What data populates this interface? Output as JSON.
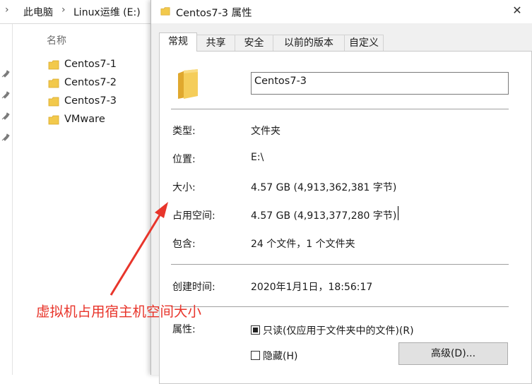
{
  "explorer": {
    "breadcrumb": [
      "此电脑",
      "Linux运维 (E:)"
    ],
    "column_header": "名称",
    "files": [
      "Centos7-1",
      "Centos7-2",
      "Centos7-3",
      "VMware"
    ]
  },
  "dialog": {
    "title": "Centos7-3 属性",
    "tabs": [
      "常规",
      "共享",
      "安全",
      "以前的版本",
      "自定义"
    ],
    "name_value": "Centos7-3",
    "rows": [
      {
        "label": "类型:",
        "value": "文件夹"
      },
      {
        "label": "位置:",
        "value": "E:\\"
      },
      {
        "label": "大小:",
        "value": "4.57 GB (4,913,362,381 字节)"
      },
      {
        "label": "占用空间:",
        "value": "4.57 GB (4,913,377,280 字节)"
      },
      {
        "label": "包含:",
        "value": "24 个文件，1 个文件夹"
      },
      {
        "label": "创建时间:",
        "value": "2020年1月1日，18:56:17"
      }
    ],
    "attributes_label": "属性:",
    "readonly_label": "只读(仅应用于文件夹中的文件)(R)",
    "readonly_checked": true,
    "hidden_label": "隐藏(H)",
    "hidden_checked": false,
    "advanced_button": "高级(D)..."
  },
  "annotation": {
    "text": "虚拟机占用宿主机空间大小",
    "color": "#e8352b"
  },
  "colors": {
    "folder": "#f2c94c",
    "dialog_bg": "#f0f0f0",
    "panel_bg": "#ffffff"
  },
  "icons": [
    "folder-icon",
    "pin-icon",
    "close-icon",
    "chevron-left-icon"
  ]
}
